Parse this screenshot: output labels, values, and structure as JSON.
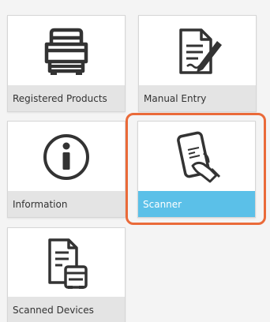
{
  "tiles": {
    "registered_products": {
      "label": "Registered Products",
      "icon": "printer-icon"
    },
    "manual_entry": {
      "label": "Manual Entry",
      "icon": "document-pen-icon"
    },
    "information": {
      "label": "Information",
      "icon": "info-icon"
    },
    "scanner": {
      "label": "Scanner",
      "icon": "phone-scan-icon",
      "selected": true
    },
    "scanned_devices": {
      "label": "Scanned Devices",
      "icon": "document-printer-icon"
    }
  },
  "colors": {
    "selected_bar": "#5bc0e8",
    "highlight_outline": "#ea6a39",
    "label_bar": "#e4e4e4"
  }
}
